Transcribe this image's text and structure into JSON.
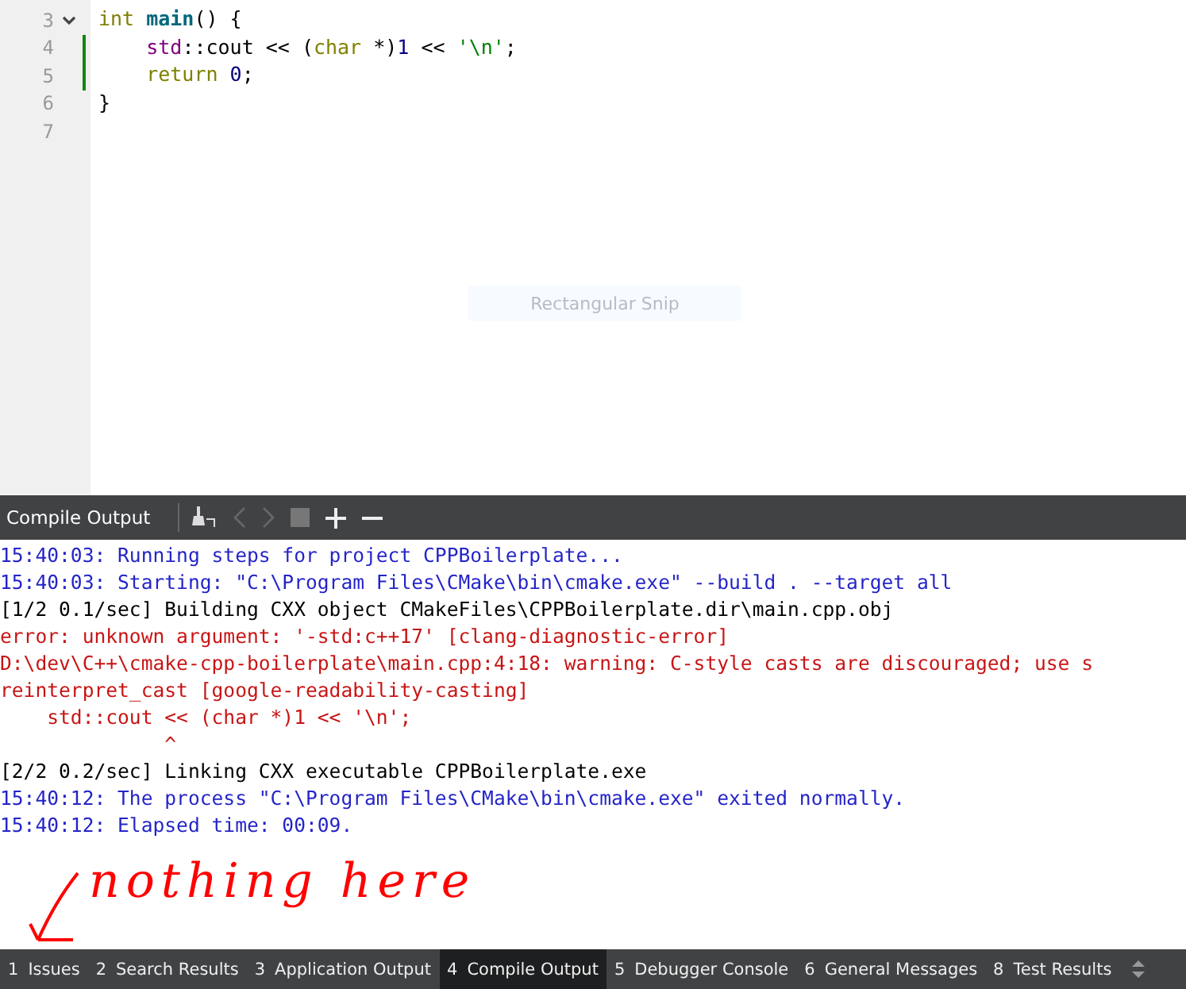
{
  "editor": {
    "lines": [
      {
        "number": "3",
        "foldable": true,
        "changed": false,
        "tokens": [
          {
            "text": "int ",
            "kind": "keyword"
          },
          {
            "text": "main",
            "kind": "function"
          },
          {
            "text": "() {",
            "kind": "plain"
          }
        ]
      },
      {
        "number": "4",
        "foldable": false,
        "changed": true,
        "tokens": [
          {
            "text": "    std",
            "kind": "namespace"
          },
          {
            "text": "::cout << (",
            "kind": "plain"
          },
          {
            "text": "char",
            "kind": "keyword"
          },
          {
            "text": " *)",
            "kind": "plain"
          },
          {
            "text": "1",
            "kind": "number"
          },
          {
            "text": " << ",
            "kind": "plain"
          },
          {
            "text": "'\\n'",
            "kind": "string"
          },
          {
            "text": ";",
            "kind": "plain"
          }
        ]
      },
      {
        "number": "5",
        "foldable": false,
        "changed": true,
        "tokens": [
          {
            "text": "    return ",
            "kind": "keyword"
          },
          {
            "text": "0",
            "kind": "number"
          },
          {
            "text": ";",
            "kind": "plain"
          }
        ]
      },
      {
        "number": "6",
        "foldable": false,
        "changed": false,
        "tokens": [
          {
            "text": "}",
            "kind": "plain"
          }
        ]
      },
      {
        "number": "7",
        "foldable": false,
        "changed": false
      }
    ],
    "snip_label": "Rectangular Snip"
  },
  "output_pane": {
    "title": "Compile Output",
    "lines": [
      {
        "text": "15:40:03: Running steps for project CPPBoilerplate...",
        "kind": "info"
      },
      {
        "text": "15:40:03: Starting: \"C:\\Program Files\\CMake\\bin\\cmake.exe\" --build . --target all",
        "kind": "info"
      },
      {
        "text": "[1/2 0.1/sec] Building CXX object CMakeFiles\\CPPBoilerplate.dir\\main.cpp.obj",
        "kind": "plain"
      },
      {
        "text": "error: unknown argument: '-std:c++17' [clang-diagnostic-error]",
        "kind": "error"
      },
      {
        "text": "D:\\dev\\C++\\cmake-cpp-boilerplate\\main.cpp:4:18: warning: C-style casts are discouraged; use s",
        "kind": "error"
      },
      {
        "text": "reinterpret_cast [google-readability-casting]",
        "kind": "error"
      },
      {
        "text": "    std::cout << (char *)1 << '\\n';",
        "kind": "error"
      },
      {
        "text": "              ^",
        "kind": "error"
      },
      {
        "text": "[2/2 0.2/sec] Linking CXX executable CPPBoilerplate.exe",
        "kind": "plain"
      },
      {
        "text": "15:40:12: The process \"C:\\Program Files\\CMake\\bin\\cmake.exe\" exited normally.",
        "kind": "info"
      },
      {
        "text": "15:40:12: Elapsed time: 00:09.",
        "kind": "info"
      }
    ],
    "annotation": "nothing here"
  },
  "bottom_tabs": [
    {
      "number": "1",
      "label": "Issues",
      "selected": false
    },
    {
      "number": "2",
      "label": "Search Results",
      "selected": false
    },
    {
      "number": "3",
      "label": "Application Output",
      "selected": false
    },
    {
      "number": "4",
      "label": "Compile Output",
      "selected": true
    },
    {
      "number": "5",
      "label": "Debugger Console",
      "selected": false
    },
    {
      "number": "6",
      "label": "General Messages",
      "selected": false
    },
    {
      "number": "8",
      "label": "Test Results",
      "selected": false
    }
  ]
}
